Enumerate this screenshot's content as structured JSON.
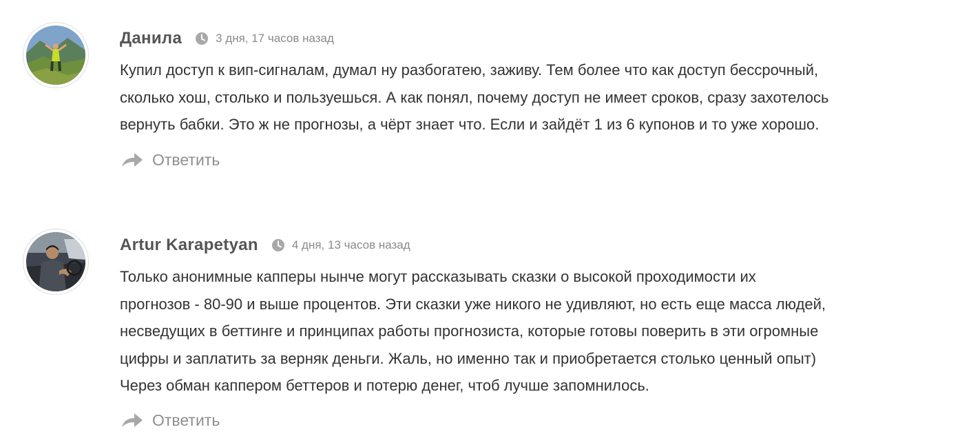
{
  "comments": [
    {
      "author": "Данила",
      "date": "3 дня, 17 часов назад",
      "text_lines": [
        "Купил доступ к вип-сигналам, думал ну разбогатею, заживу. Тем более что как доступ бессрочный,",
        "сколько хош, столько и пользуешься. А как понял, почему доступ не имеет сроков, сразу захотелось",
        "вернуть бабки. Это ж не прогнозы, а чёрт знает что. Если и зайдёт 1 из 6 купонов и то уже хорошо."
      ],
      "reply_label": "Ответить"
    },
    {
      "author": "Artur Karapetyan",
      "date": "4 дня, 13 часов назад",
      "text_lines": [
        "Только анонимные капперы нынче могут рассказывать сказки о высокой проходимости их",
        "прогнозов - 80-90 и выше процентов. Эти сказки уже никого не удивляют, но есть еще масса людей,",
        "несведущих в беттинге и принципах работы прогнозиста, которые готовы поверить в эти огромные",
        "цифры и заплатить за верняк деньги. Жаль, но именно так и приобретается столько ценный опыт)",
        "Через обман каппером беттеров и потерю денег, чтоб лучше запомнилось."
      ],
      "reply_label": "Ответить"
    }
  ],
  "icons": {
    "clock": "clock-icon",
    "reply": "reply-arrow-icon"
  },
  "colors": {
    "author": "#555555",
    "date": "#8a8a8a",
    "text": "#333333",
    "reply": "#8f8f8f",
    "icon": "#a8a8a8"
  }
}
